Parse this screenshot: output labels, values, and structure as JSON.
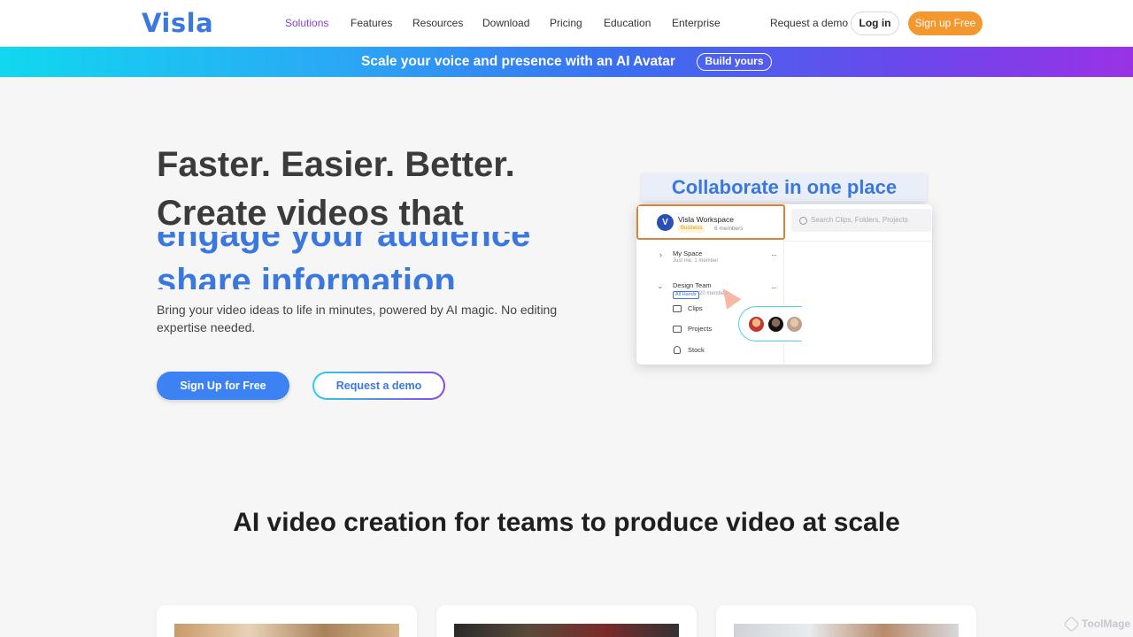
{
  "header": {
    "logo": "Visla",
    "nav": [
      "Solutions",
      "Features",
      "Resources",
      "Download",
      "Pricing",
      "Education",
      "Enterprise"
    ],
    "request_demo": "Request a demo",
    "login": "Log in",
    "signup": "Sign up Free"
  },
  "banner": {
    "text": "Scale your voice and presence with an AI Avatar",
    "cta": "Build yours"
  },
  "hero": {
    "line1": "Faster. Easier. Better.",
    "line2": "Create videos that",
    "rotating": [
      "engage your audience",
      "share information"
    ],
    "subtitle": "Bring your video ideas to life in minutes, powered by AI magic. No editing expertise needed.",
    "cta_primary": "Sign Up for Free",
    "cta_secondary": "Request a demo"
  },
  "mockup": {
    "title": "Collaborate in one place",
    "workspace_name": "Visla Workspace",
    "workspace_badge": "Business",
    "workspace_members": "6 members",
    "search_placeholder": "Search Clips, Folders, Projects",
    "my_space": "My Space",
    "my_space_sub": "Just me, 1 member",
    "design_team": "Design Team",
    "all_hands": "All Hands",
    "design_team_sub": "20 members",
    "items": [
      "Clips",
      "Projects",
      "Stock"
    ],
    "more": "···"
  },
  "section": {
    "title": "AI video creation for teams to produce video at scale"
  },
  "watermark": "ToolMage",
  "colors": {
    "brand_blue": "#3a78e0",
    "nav_active": "#8b3fd6",
    "signup_orange": "#f3972f"
  }
}
